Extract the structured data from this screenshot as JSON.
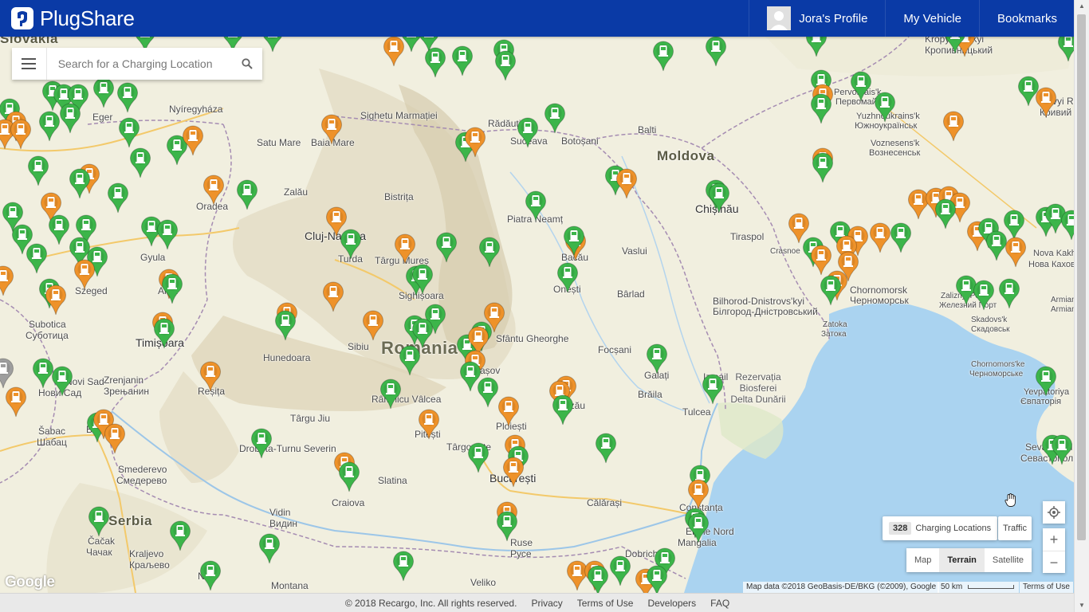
{
  "header": {
    "brand": "PlugShare",
    "nav": [
      "Jora's Profile",
      "My Vehicle",
      "Bookmarks"
    ]
  },
  "search": {
    "placeholder": "Search for a Charging Location"
  },
  "map_controls": {
    "location_count": "328",
    "location_label": "Charging Locations",
    "traffic_label": "Traffic",
    "map_types": [
      "Map",
      "Terrain",
      "Satellite"
    ],
    "active_map_type": "Terrain",
    "zoom_in": "+",
    "zoom_out": "−",
    "google_logo": "Google",
    "map_data": "Map data ©2018 GeoBasis-DE/BKG (©2009), Google",
    "scale": "50 km",
    "terms": "Terms of Use"
  },
  "colors": {
    "header": "#0a3aa6",
    "pin_green": "#3cb54a",
    "pin_orange": "#ee922a",
    "sea": "#aad3f0"
  },
  "places": [
    "Slovakia",
    "Nyíregyháza",
    "Eger",
    "Satu Mare",
    "Baia Mare",
    "Sighetu Marmației",
    "Rădăuți",
    "Suceava",
    "Botoșani",
    "Balti",
    "Moldova",
    "Chișinău",
    "Tiraspol",
    "Oradea",
    "Zalău",
    "Bistrița",
    "Cluj-Napoca",
    "Turda",
    "Târgu Mureș",
    "Sighișoara",
    "Piatra Neamț",
    "Bacău",
    "Vaslui",
    "Onești",
    "Bârlad",
    "Gyula",
    "Szeged",
    "Subotica",
    "Суботица",
    "Arad",
    "Timișoara",
    "Hunedoara",
    "Sibiu",
    "Romania",
    "Sfântu Gheorghe",
    "Brașov",
    "Focșani",
    "Galați",
    "Brăila",
    "Izmail",
    "Tulcea",
    "Rezervația Biosferei Delta Dunării",
    "Reșița",
    "Zrenjanin",
    "Зрењанин",
    "Novi Sad",
    "Нови Сад",
    "Târgu Jiu",
    "Râmnicu Vâlcea",
    "Pitești",
    "Târgoviște",
    "Ploiești",
    "Buzău",
    "București",
    "Craiova",
    "Slatina",
    "Călărași",
    "Constanța",
    "Eforie Nord",
    "Mangalia",
    "Drobeta-Turnu Severin",
    "Šabac",
    "Шабац",
    "Beograd",
    "Smederevo",
    "Смедерево",
    "Serbia",
    "Čačak",
    "Чачак",
    "Kraljevo",
    "Краљево",
    "Niš",
    "Vidin",
    "Видин",
    "Montana",
    "Ruse",
    "Русе",
    "Veliko",
    "Dobrich",
    "Bilhorod-Dnistrovs'kyi",
    "Білгород-Дністровський",
    "Chornomorsk",
    "Черноморськ",
    "Zatoka",
    "Затока",
    "Pervomais'k",
    "Первомайськ",
    "Yuzhnoukrains'k",
    "Южноукраїнськ",
    "Voznesens'k",
    "Вознесенськ",
    "Kryvyi Rih",
    "Кривий Ріг",
    "Kropyvnytskyi",
    "Кропивницький",
    "Nova Kakhovka",
    "Нова Каховка",
    "Skadovs'k",
    "Скадовськ",
    "Zaliznyi Port",
    "Железний Порт",
    "Chornomors'ke",
    "Черноморське",
    "Yevpatoriya",
    "Євпаторія",
    "Sevastopol",
    "Севастополь",
    "Crasnoe",
    "Armiansk",
    "Armians'k"
  ],
  "footer": {
    "copyright": "© 2018 Recargo, Inc. All rights reserved.",
    "links": [
      "Privacy",
      "Terms of Use",
      "Developers",
      "FAQ"
    ]
  }
}
